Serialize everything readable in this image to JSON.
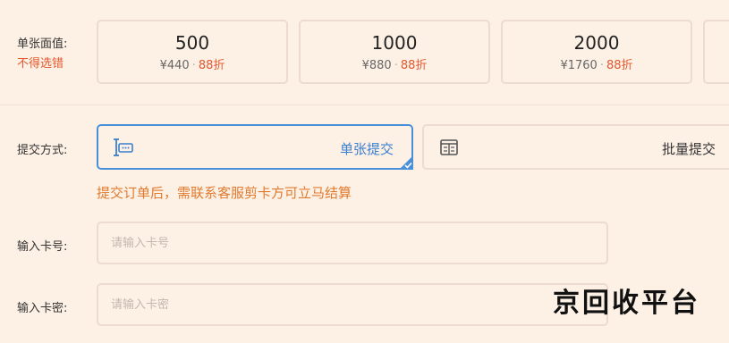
{
  "denomination": {
    "label": "单张面值:",
    "note": "不得选错",
    "cards": [
      {
        "value": "500",
        "price": "¥440",
        "separator": "·",
        "discount": "88折"
      },
      {
        "value": "1000",
        "price": "¥880",
        "separator": "·",
        "discount": "88折"
      },
      {
        "value": "2000",
        "price": "¥1760",
        "separator": "·",
        "discount": "88折"
      }
    ]
  },
  "submit_method": {
    "label": "提交方式:",
    "options": [
      {
        "label": "单张提交",
        "icon": "single-card-icon",
        "selected": true
      },
      {
        "label": "批量提交",
        "icon": "batch-card-icon",
        "selected": false
      }
    ],
    "notice": "提交订单后，需联系客服剪卡方可立马结算"
  },
  "card_number": {
    "label": "输入卡号:",
    "placeholder": "请输入卡号",
    "value": ""
  },
  "card_password": {
    "label": "输入卡密:",
    "placeholder": "请输入卡密",
    "value": ""
  },
  "watermark": "京回收平台",
  "colors": {
    "background": "#fdf1e6",
    "accent_blue": "#4a90d9",
    "discount_red": "#e4572e",
    "notice_orange": "#e07a2e"
  }
}
